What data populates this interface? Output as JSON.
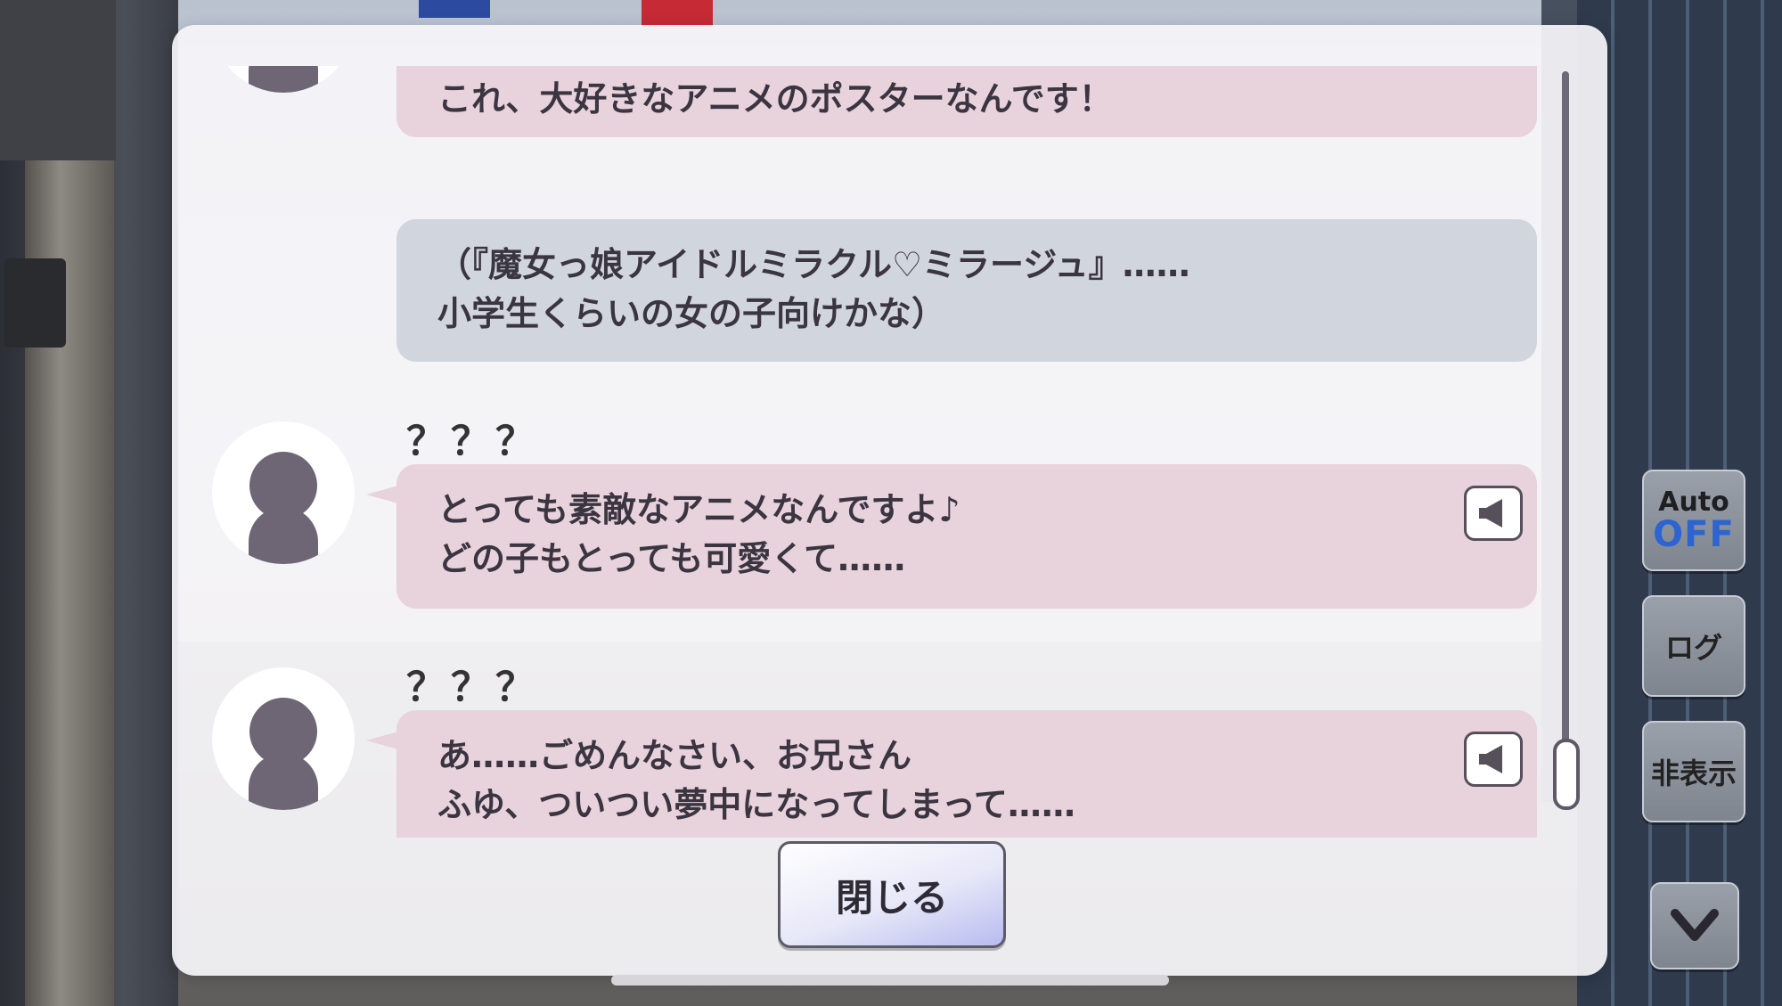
{
  "backlog": {
    "entries": [
      {
        "speaker": "",
        "has_avatar": true,
        "bubble": "pink",
        "lines": [
          "これ、大好きなアニメのポスターなんです！"
        ],
        "has_voice": true
      },
      {
        "speaker": "",
        "has_avatar": false,
        "bubble": "gray",
        "lines": [
          "（『魔女っ娘アイドルミラクル♡ミラージュ』……",
          "小学生くらいの女の子向けかな）"
        ],
        "has_voice": false
      },
      {
        "speaker": "？？？",
        "has_avatar": true,
        "bubble": "pink",
        "lines": [
          "とっても素敵なアニメなんですよ♪",
          "どの子もとっても可愛くて……"
        ],
        "has_voice": true
      },
      {
        "speaker": "？？？",
        "has_avatar": true,
        "bubble": "pink",
        "lines": [
          "あ……ごめんなさい、お兄さん",
          "ふゆ、ついつい夢中になってしまって……"
        ],
        "has_voice": true
      }
    ],
    "close_label": "閉じる"
  },
  "side_controls": {
    "auto_label": "Auto",
    "auto_state": "OFF",
    "log_label": "ログ",
    "hide_label": "非表示"
  },
  "colors": {
    "bubble_pink": "#e8d2dc",
    "bubble_gray": "#d1d5dd",
    "auto_off": "#2e64cf"
  },
  "icons": [
    "speaker-icon",
    "chevron-down-icon",
    "avatar-silhouette-icon"
  ],
  "scroll_position": 1.0
}
